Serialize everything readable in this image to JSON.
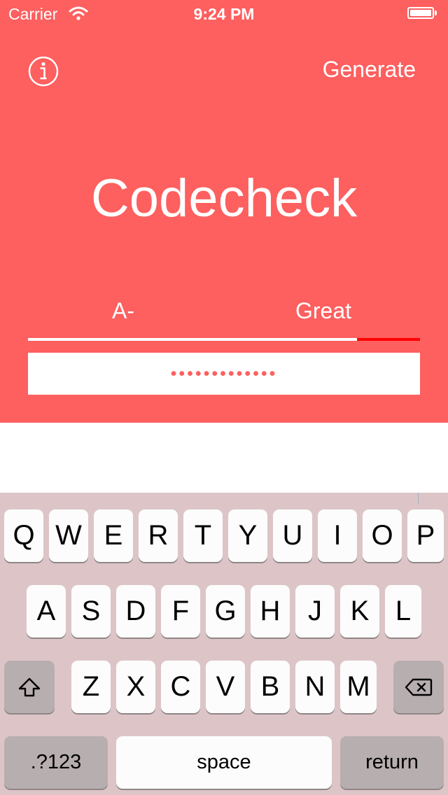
{
  "status_bar": {
    "carrier": "Carrier",
    "time": "9:24 PM"
  },
  "header": {
    "info_icon": "info-icon",
    "generate_label": "Generate",
    "title": "Codecheck"
  },
  "strength": {
    "grade": "A-",
    "rating": "Great",
    "level": 0.84
  },
  "password_field": {
    "masked_value": "•••••••••••••"
  },
  "colors": {
    "accent": "#fe5f5f",
    "meter_track": "#ff0000",
    "keyboard_bg": "#ddc5c7"
  },
  "keyboard": {
    "row1": [
      "Q",
      "W",
      "E",
      "R",
      "T",
      "Y",
      "U",
      "I",
      "O",
      "P"
    ],
    "row2": [
      "A",
      "S",
      "D",
      "F",
      "G",
      "H",
      "J",
      "K",
      "L"
    ],
    "row3": [
      "Z",
      "X",
      "C",
      "V",
      "B",
      "N",
      "M"
    ],
    "shift_icon": "shift-icon",
    "delete_icon": "delete-icon",
    "numbers_label": ".?123",
    "space_label": "space",
    "return_label": "return"
  }
}
